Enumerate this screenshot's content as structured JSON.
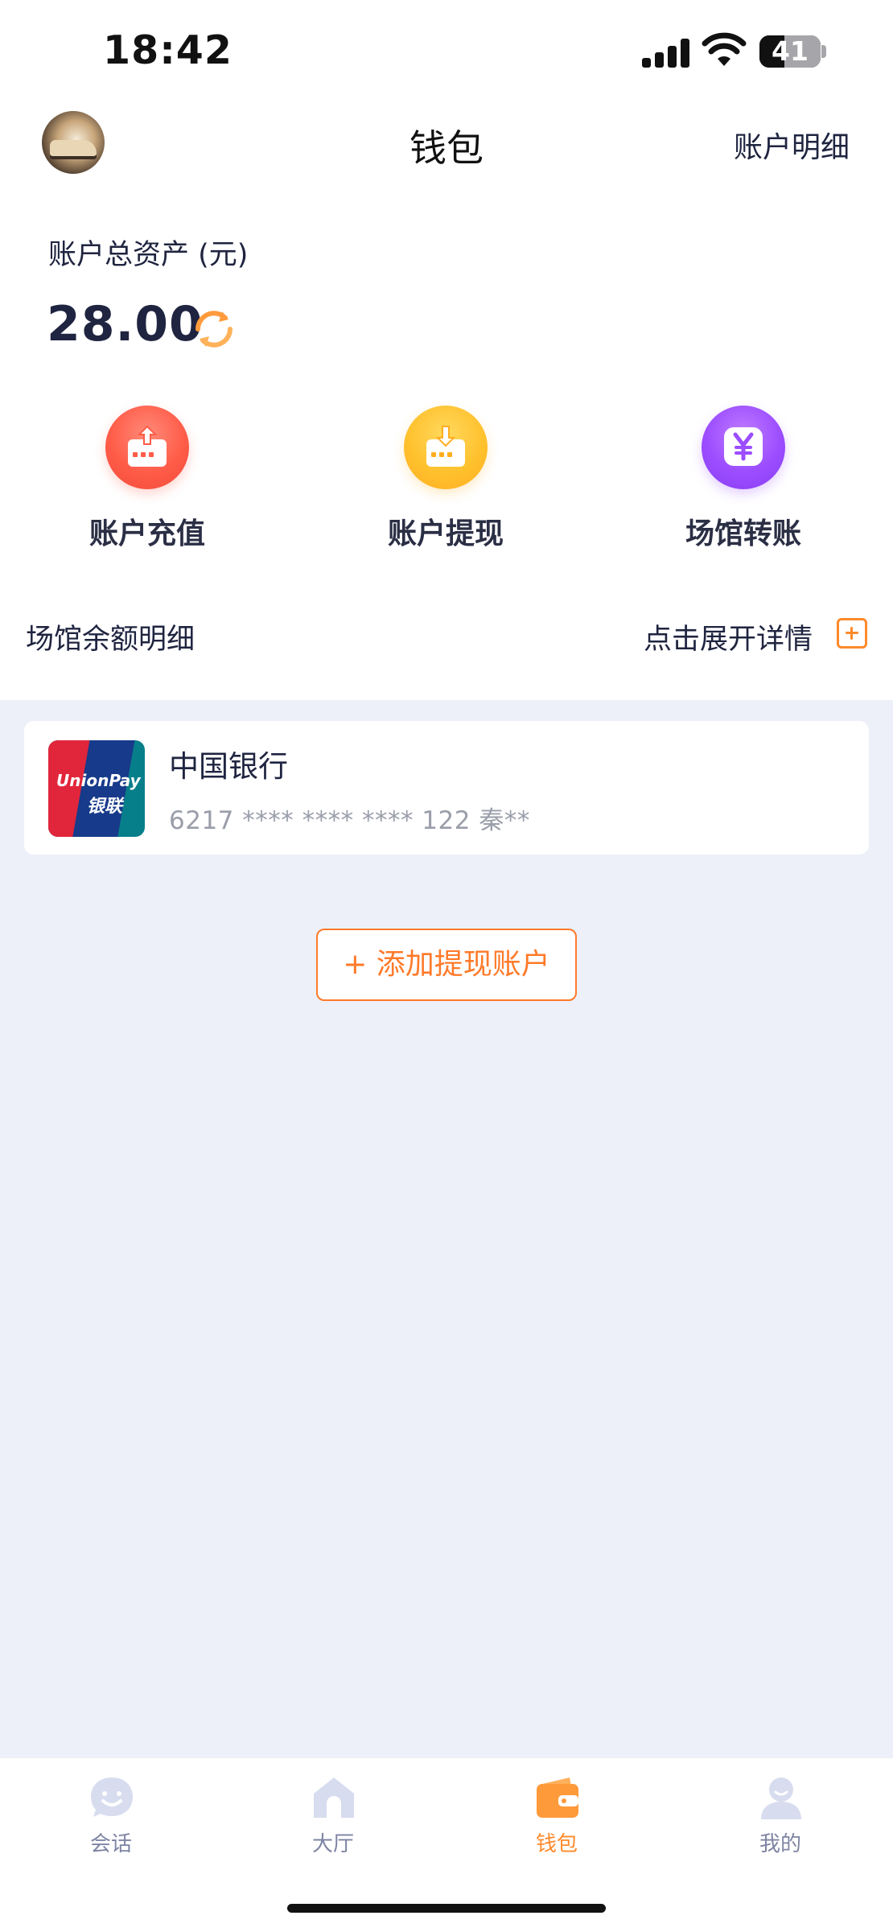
{
  "status_bar": {
    "time": "18:42",
    "battery": "41"
  },
  "nav": {
    "title": "钱包",
    "right_link": "账户明细"
  },
  "assets": {
    "label": "账户总资产 (元)",
    "value": "28.00"
  },
  "actions": [
    {
      "label": "账户充值",
      "icon": "deposit-icon",
      "color": "#ff5c48"
    },
    {
      "label": "账户提现",
      "icon": "withdraw-icon",
      "color": "#ffc12e"
    },
    {
      "label": "场馆转账",
      "icon": "yuan-transfer-icon",
      "color": "#9b4dff"
    }
  ],
  "venue": {
    "label": "场馆余额明细",
    "expand": "点击展开详情"
  },
  "bank_card": {
    "logo_text1": "UnionPay",
    "logo_text2": "银联",
    "name": "中国银行",
    "number": "6217 **** **** **** 122  秦**"
  },
  "add_account": "+ 添加提现账户",
  "tabbar": [
    {
      "label": "会话",
      "icon": "chat-icon",
      "active": false
    },
    {
      "label": "大厅",
      "icon": "home-icon",
      "active": false
    },
    {
      "label": "钱包",
      "icon": "wallet-icon",
      "active": true
    },
    {
      "label": "我的",
      "icon": "profile-icon",
      "active": false
    }
  ],
  "colors": {
    "accent": "#ff8a2b",
    "background": "#edf0f8",
    "text": "#1f2440"
  }
}
